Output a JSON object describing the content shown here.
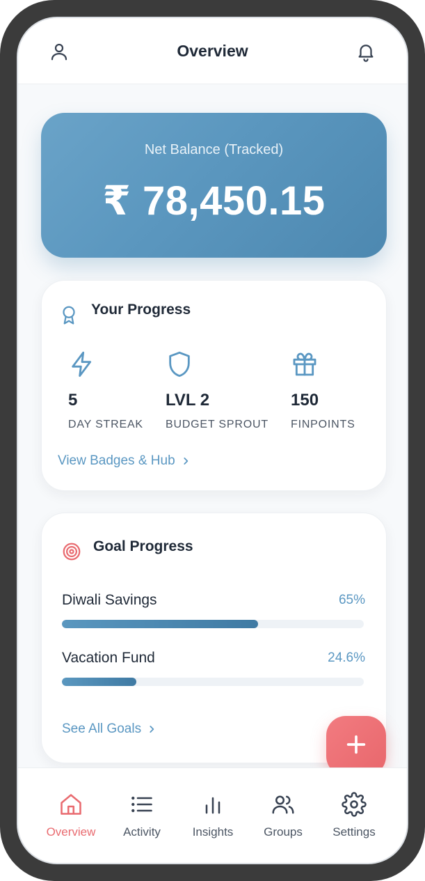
{
  "header": {
    "title": "Overview",
    "left_icon": "user-icon",
    "right_icon": "bell-icon"
  },
  "balance": {
    "label": "Net Balance (Tracked)",
    "value": "₹ 78,450.15"
  },
  "progress": {
    "title": "Your Progress",
    "icon": "award-ribbon-icon",
    "stats": [
      {
        "icon": "lightning-icon",
        "value": "5",
        "label": "DAY STREAK"
      },
      {
        "icon": "shield-icon",
        "value": "LVL 2",
        "label": "BUDGET SPROUT"
      },
      {
        "icon": "gift-icon",
        "value": "150",
        "label": "FINPOINTS"
      }
    ],
    "link": "View Badges & Hub"
  },
  "goals": {
    "title": "Goal Progress",
    "icon": "target-icon",
    "items": [
      {
        "name": "Diwali Savings",
        "percent_text": "65%",
        "fraction": 0.65
      },
      {
        "name": "Vacation Fund",
        "percent_text": "24.6%",
        "fraction": 0.246
      }
    ],
    "link": "See All Goals"
  },
  "fab": {
    "icon": "plus-icon"
  },
  "nav": {
    "items": [
      {
        "label": "Overview",
        "icon": "home-icon",
        "active": true
      },
      {
        "label": "Activity",
        "icon": "list-icon",
        "active": false
      },
      {
        "label": "Insights",
        "icon": "bar-chart-icon",
        "active": false
      },
      {
        "label": "Groups",
        "icon": "users-icon",
        "active": false
      },
      {
        "label": "Settings",
        "icon": "gear-icon",
        "active": false
      }
    ]
  },
  "colors": {
    "accent": "#5a97c2",
    "active_nav": "#e96b70",
    "fab": "#ec6f74",
    "card_gradient_start": "#6aa3c8",
    "card_gradient_end": "#4d88b0"
  }
}
